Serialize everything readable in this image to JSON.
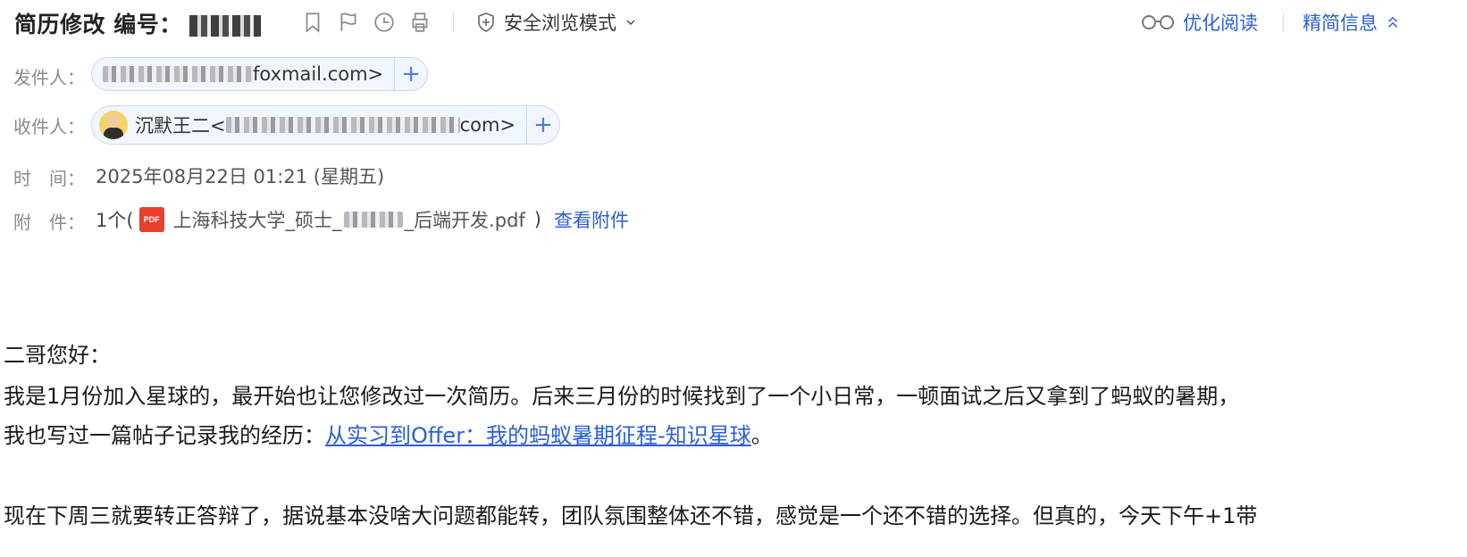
{
  "header": {
    "subject": "简历修改 编号：",
    "safe_mode_label": "安全浏览模式",
    "optimize_read_label": "优化阅读",
    "simplify_label": "精简信息"
  },
  "meta": {
    "from_label": "发件人：",
    "from_address_suffix": "foxmail.com>",
    "to_label": "收件人：",
    "to_name": "沉默王二<",
    "to_address_suffix": "com>",
    "time_label": "时　间：",
    "time_value": "2025年08月22日 01:21 (星期五)",
    "attach_label": "附　件：",
    "attach_count": "1个(",
    "attach_file_prefix": "上海科技大学_硕士_",
    "attach_file_suffix": "_后端开发.pdf",
    "attach_close": ")",
    "view_attachment": "查看附件",
    "pdf_badge": "PDF"
  },
  "body": {
    "greeting": "二哥您好：",
    "line1": "我是1月份加入星球的，最开始也让您修改过一次简历。后来三月份的时候找到了一个小日常，一顿面试之后又拿到了蚂蚁的暑期，",
    "line2_prefix": "我也写过一篇帖子记录我的经历：",
    "line2_link": "从实习到Offer：我的蚂蚁暑期征程-知识星球",
    "line2_suffix": "。",
    "line3": "现在下周三就要转正答辩了，据说基本没啥大问题都能转，团队氛围整体还不错，感觉是一个还不错的选择。但真的，今天下午+1带"
  },
  "icons": [
    "bookmark-icon",
    "flag-icon",
    "clock-icon",
    "print-icon",
    "shield-icon",
    "chevron-down-icon",
    "glasses-icon",
    "chevron-up-icon",
    "plus-icon",
    "pdf-icon"
  ],
  "colors": {
    "link": "#2a5fd6",
    "pill_border": "#c8d6f5",
    "pill_bg": "#f1f5fe",
    "pdf": "#e8402c"
  }
}
